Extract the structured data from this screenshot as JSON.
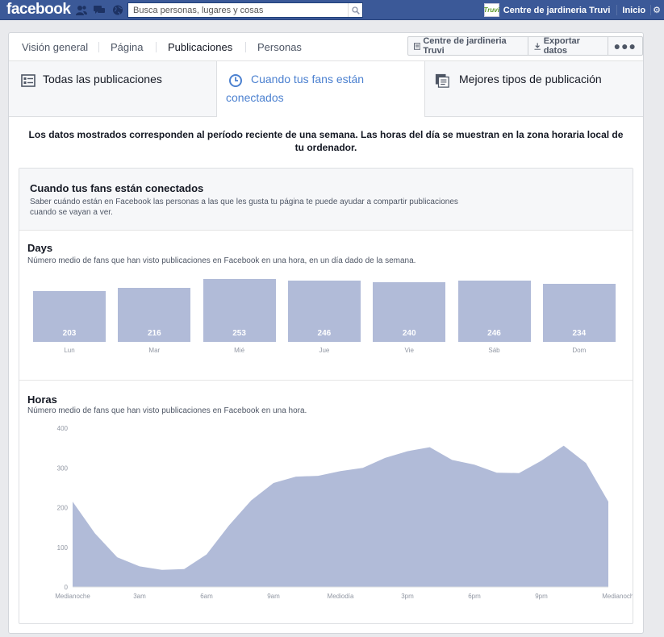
{
  "topbar": {
    "logo": "facebook",
    "search_placeholder": "Busca personas, lugares y cosas",
    "avatar_text": "Truvi",
    "user_name": "Centre de jardineria Truvi",
    "home": "Inicio"
  },
  "subnav": {
    "tabs": [
      "Visión general",
      "Página",
      "Publicaciones",
      "Personas"
    ],
    "active": "Publicaciones",
    "page_button": "Centre de jardineria Truvi",
    "export_button": "Exportar datos",
    "more_button": "●●●"
  },
  "subtabs": [
    {
      "label": "Todas las publicaciones",
      "icon": "list-icon"
    },
    {
      "label_line1": "Cuando tus fans están",
      "label_line2": "conectados",
      "icon": "clock-icon"
    },
    {
      "label": "Mejores tipos de publicación",
      "icon": "post-types-icon"
    }
  ],
  "notice": "Los datos mostrados corresponden al período reciente de una semana. Las horas del día se muestran en la zona horaria local de tu ordenador.",
  "card": {
    "title": "Cuando tus fans están conectados",
    "description": "Saber cuándo están en Facebook las personas a las que les gusta tu página te puede ayudar a compartir publicaciones cuando se vayan a ver.",
    "days": {
      "title": "Days",
      "description": "Número medio de fans que han visto publicaciones en Facebook en una hora, en un día dado de la semana."
    },
    "hours": {
      "title": "Horas",
      "description": "Número medio de fans que han visto publicaciones en Facebook en una hora."
    }
  },
  "colors": {
    "topbar": "#3b5998",
    "bar_fill": "#b1bbd8",
    "active_link": "#4c81d0"
  },
  "chart_data": [
    {
      "type": "bar",
      "title": "Days",
      "categories": [
        "Lun",
        "Mar",
        "Mié",
        "Jue",
        "Vie",
        "Sáb",
        "Dom"
      ],
      "values": [
        203,
        216,
        253,
        246,
        240,
        246,
        234
      ],
      "data_labels": [
        "203",
        "216",
        "253",
        "246",
        "240",
        "246",
        "234"
      ]
    },
    {
      "type": "area",
      "title": "Horas",
      "x": [
        0,
        1,
        2,
        3,
        4,
        5,
        6,
        7,
        8,
        9,
        10,
        11,
        12,
        13,
        14,
        15,
        16,
        17,
        18,
        19,
        20,
        21,
        22,
        23,
        24
      ],
      "values": [
        215,
        135,
        75,
        52,
        43,
        45,
        82,
        155,
        218,
        262,
        278,
        280,
        292,
        300,
        325,
        342,
        352,
        320,
        308,
        288,
        287,
        318,
        356,
        312,
        215
      ],
      "yticks": [
        "0",
        "100",
        "200",
        "300",
        "400"
      ],
      "ylim": [
        0,
        400
      ],
      "xtick_labels": [
        "Medianoche",
        "3am",
        "6am",
        "9am",
        "Mediodía",
        "3pm",
        "6pm",
        "9pm",
        "Medianoche"
      ],
      "grid": false
    }
  ]
}
